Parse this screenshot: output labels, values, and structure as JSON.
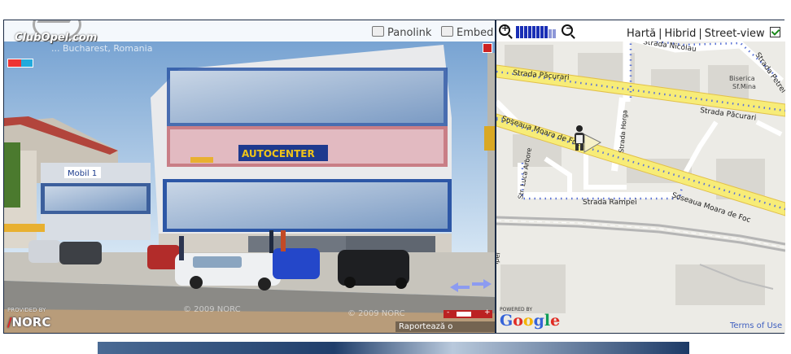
{
  "pano": {
    "brand": "ClubOpel.com",
    "location": "... Bucharest, Romania",
    "toolbar": {
      "panolink": "Panolink",
      "embed": "Embed"
    },
    "storefront_sign": "AUTOCENTER",
    "sign_small": "Mobil 1",
    "provided_by": "PROVIDED BY",
    "provider": "NORC",
    "copyright_a": "© 2009 NORC",
    "copyright_b": "© 2009 NORC",
    "zoom_minus": "-",
    "zoom_plus": "+",
    "report_link": "Raportează o problemă"
  },
  "map": {
    "zoom_levels": 10,
    "zoom_current": 8,
    "types": {
      "harta": "Hartă",
      "hibrid": "Hibrid",
      "streetview": "Street-view"
    },
    "streetview_checked": true,
    "streets": {
      "nicolau": "Strada Nicolau",
      "petrel": "Strada Petrel",
      "pacurari_w": "Strada Păcurari",
      "pacurari_e": "Strada Păcurari",
      "biserica": "Biserica",
      "sfmina": "Sf.Mina",
      "horga": "Strada Horga",
      "moara_w": "Șoseaua Moara de Foc",
      "moara_e": "Șoseaua Moara de Foc",
      "arbore": "Str. Luca Arbore",
      "rampei": "Strada Rampei",
      "ipei": "ipei"
    },
    "powered_by": "POWERED BY",
    "google": [
      "G",
      "o",
      "o",
      "g",
      "l",
      "e"
    ],
    "google_colors": [
      "#3563d8",
      "#e02c24",
      "#f4b400",
      "#3563d8",
      "#109d58",
      "#e02c24"
    ],
    "terms": "Terms of Use"
  }
}
